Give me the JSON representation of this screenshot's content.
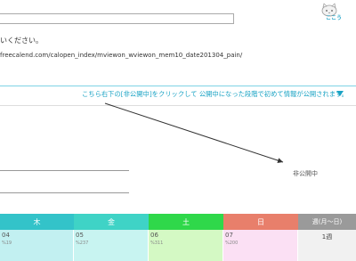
{
  "page": {
    "instruction_text": "いください。",
    "url_text": "freecalend.com/calopen_index/mviewon_wviewon_mem10_date201304_pain/",
    "logo_text": "ここう"
  },
  "notice": {
    "text": "こちら右下の[非公開中]をクリックして 公開中になった段階で初めて情報が公開されます。"
  },
  "status": {
    "private_label": "非公開中"
  },
  "calendar": {
    "headers": [
      "木",
      "金",
      "土",
      "日",
      "週(月～日)"
    ],
    "header_colors": [
      "#33c3c9",
      "#3fd3c6",
      "#2fd84a",
      "#e87f6b",
      "#9a9a9a"
    ],
    "body_colors": [
      "#c2f0f1",
      "#c8f4f1",
      "#d4f9c4",
      "#fbe0f4",
      "#f1f1f1"
    ],
    "days": [
      {
        "num": "04",
        "sub": "%19"
      },
      {
        "num": "05",
        "sub": "%237"
      },
      {
        "num": "06",
        "sub": "%311"
      },
      {
        "num": "07",
        "sub": "%200"
      }
    ],
    "week_label": "1週"
  }
}
